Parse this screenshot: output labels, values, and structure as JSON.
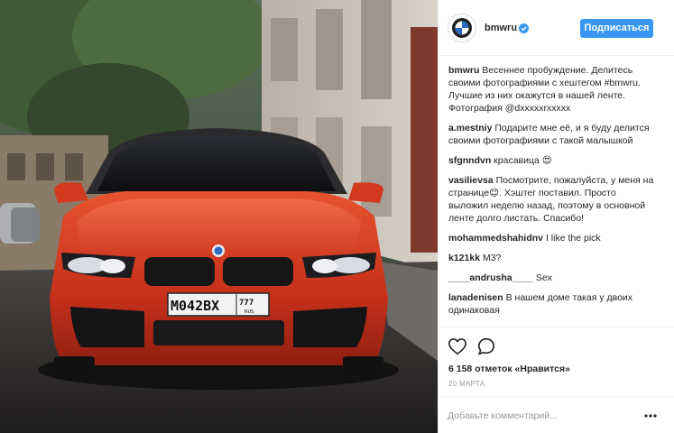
{
  "post": {
    "username": "bmwru",
    "follow_label": "Подписаться",
    "likes_text": "6 158 отметок «Нравится»",
    "date": "20 МАРТА",
    "comment_placeholder": "Добавьте комментарий...",
    "accent_color": "#3897f0"
  },
  "comments": [
    {
      "author": "bmwru",
      "text": "Весеннее пробуждение. Делитесь своими фотографиями с хештегом #bmwru.\nЛучшие из них окажутся в нашей ленте.\nФотография @dxxxxxrxxxxx"
    },
    {
      "author": "a.mestniy",
      "text": "Подарите мне её, и я буду делится своими фотографиями с такой малышкой"
    },
    {
      "author": "sfgnndvn",
      "text": "красавица 😍"
    },
    {
      "author": "vasilievsa",
      "text": "Посмотрите, пожалуйста, у меня на странице😊. Хэштег поставил. Просто выложил неделю назад, поэтому в основной ленте долго листать. Спасибо!"
    },
    {
      "author": "mohammedshahidnv",
      "text": "I like the pick"
    },
    {
      "author": "k121kk",
      "text": "M3?"
    },
    {
      "author": "____andrusha____",
      "text": "Sex"
    },
    {
      "author": "lanadenisen",
      "text": "В нашем доме такая у двоих одинаковая"
    }
  ],
  "photo": {
    "plate_number": "М042ВХ",
    "plate_region": "777",
    "plate_country": "RUS"
  },
  "icons": [
    "bmw-logo-icon",
    "verified-icon",
    "heart-icon",
    "comment-icon",
    "more-icon"
  ]
}
